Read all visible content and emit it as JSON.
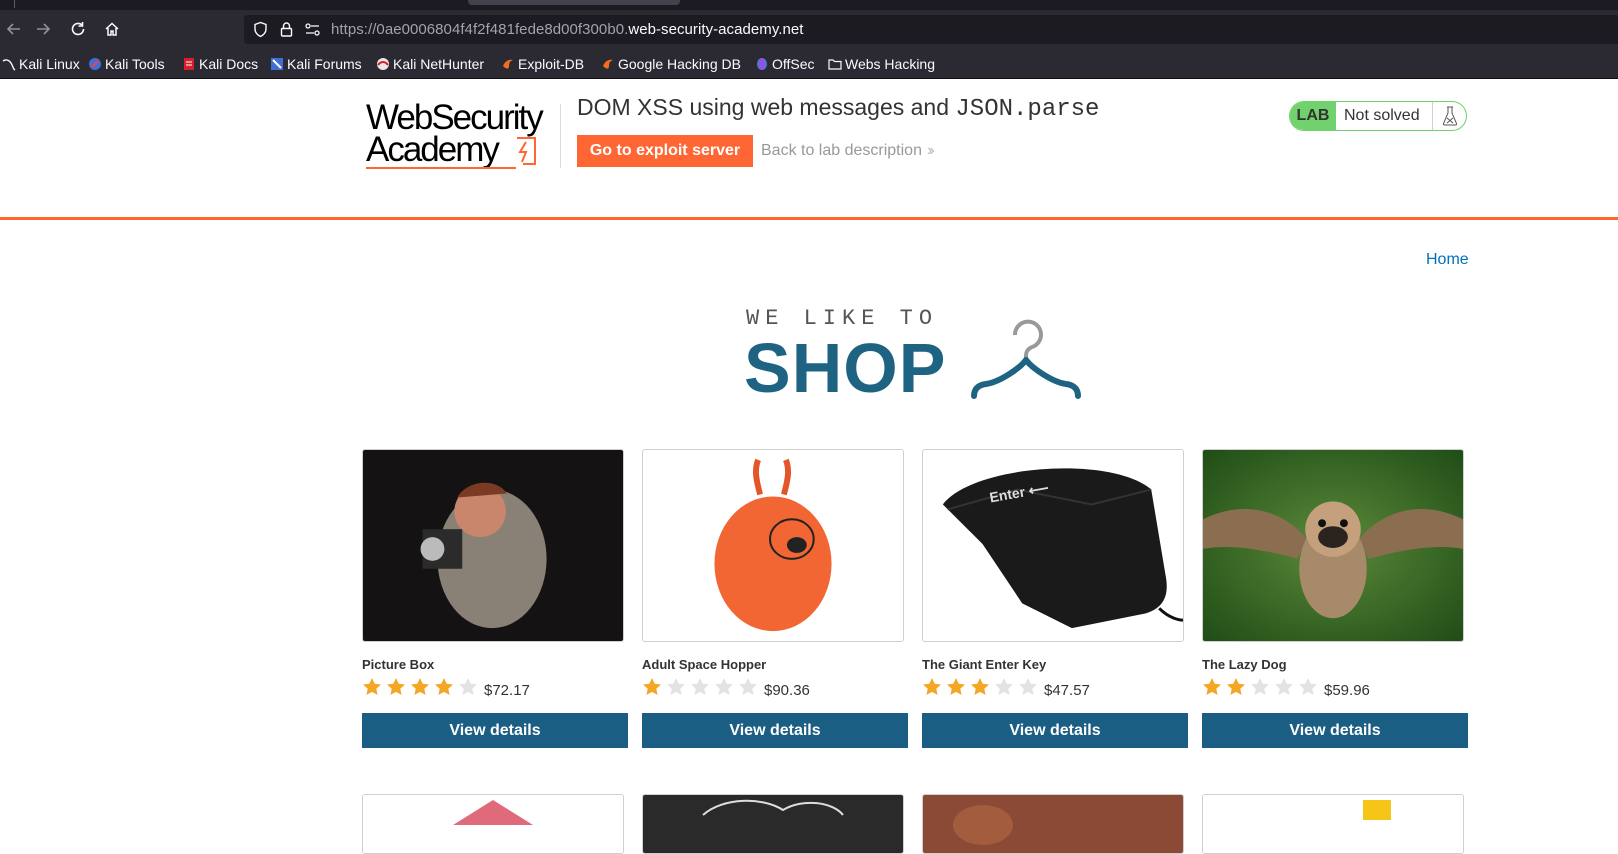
{
  "browser": {
    "url_prefix": "https://0ae0006804f4f2f481fede8d00f300b0.",
    "url_domain": "web-security-academy.net",
    "bookmarks": [
      {
        "label": "Kali Linux",
        "icon": "kali-dragon-icon"
      },
      {
        "label": "Kali Tools",
        "icon": "kali-tools-icon"
      },
      {
        "label": "Kali Docs",
        "icon": "kali-docs-icon"
      },
      {
        "label": "Kali Forums",
        "icon": "kali-forums-icon"
      },
      {
        "label": "Kali NetHunter",
        "icon": "nethunter-icon"
      },
      {
        "label": "Exploit-DB",
        "icon": "exploit-db-icon"
      },
      {
        "label": "Google Hacking DB",
        "icon": "ghdb-icon"
      },
      {
        "label": "OffSec",
        "icon": "offsec-icon"
      },
      {
        "label": "Webs Hacking",
        "icon": "folder-icon"
      }
    ]
  },
  "lab": {
    "logo_line1": "WebSecurity",
    "logo_line2": "Academy",
    "title_text": "DOM XSS using web messages and ",
    "title_code": "JSON.parse",
    "exploit_button": "Go to exploit server",
    "back_link": "Back to lab description",
    "status_tag": "LAB",
    "status_text": "Not solved",
    "accent_color": "#ff6633",
    "status_color": "#70d16d"
  },
  "shop": {
    "home_link": "Home",
    "tagline": "WE LIKE TO",
    "word": "SHOP",
    "brand_color": "#1e6482",
    "view_button_label": "View details",
    "products": [
      {
        "name": "Picture Box",
        "rating": 4,
        "price": "$72.17"
      },
      {
        "name": "Adult Space Hopper",
        "rating": 1,
        "price": "$90.36"
      },
      {
        "name": "The Giant Enter Key",
        "rating": 3,
        "price": "$47.57"
      },
      {
        "name": "The Lazy Dog",
        "rating": 2,
        "price": "$59.96"
      }
    ]
  }
}
